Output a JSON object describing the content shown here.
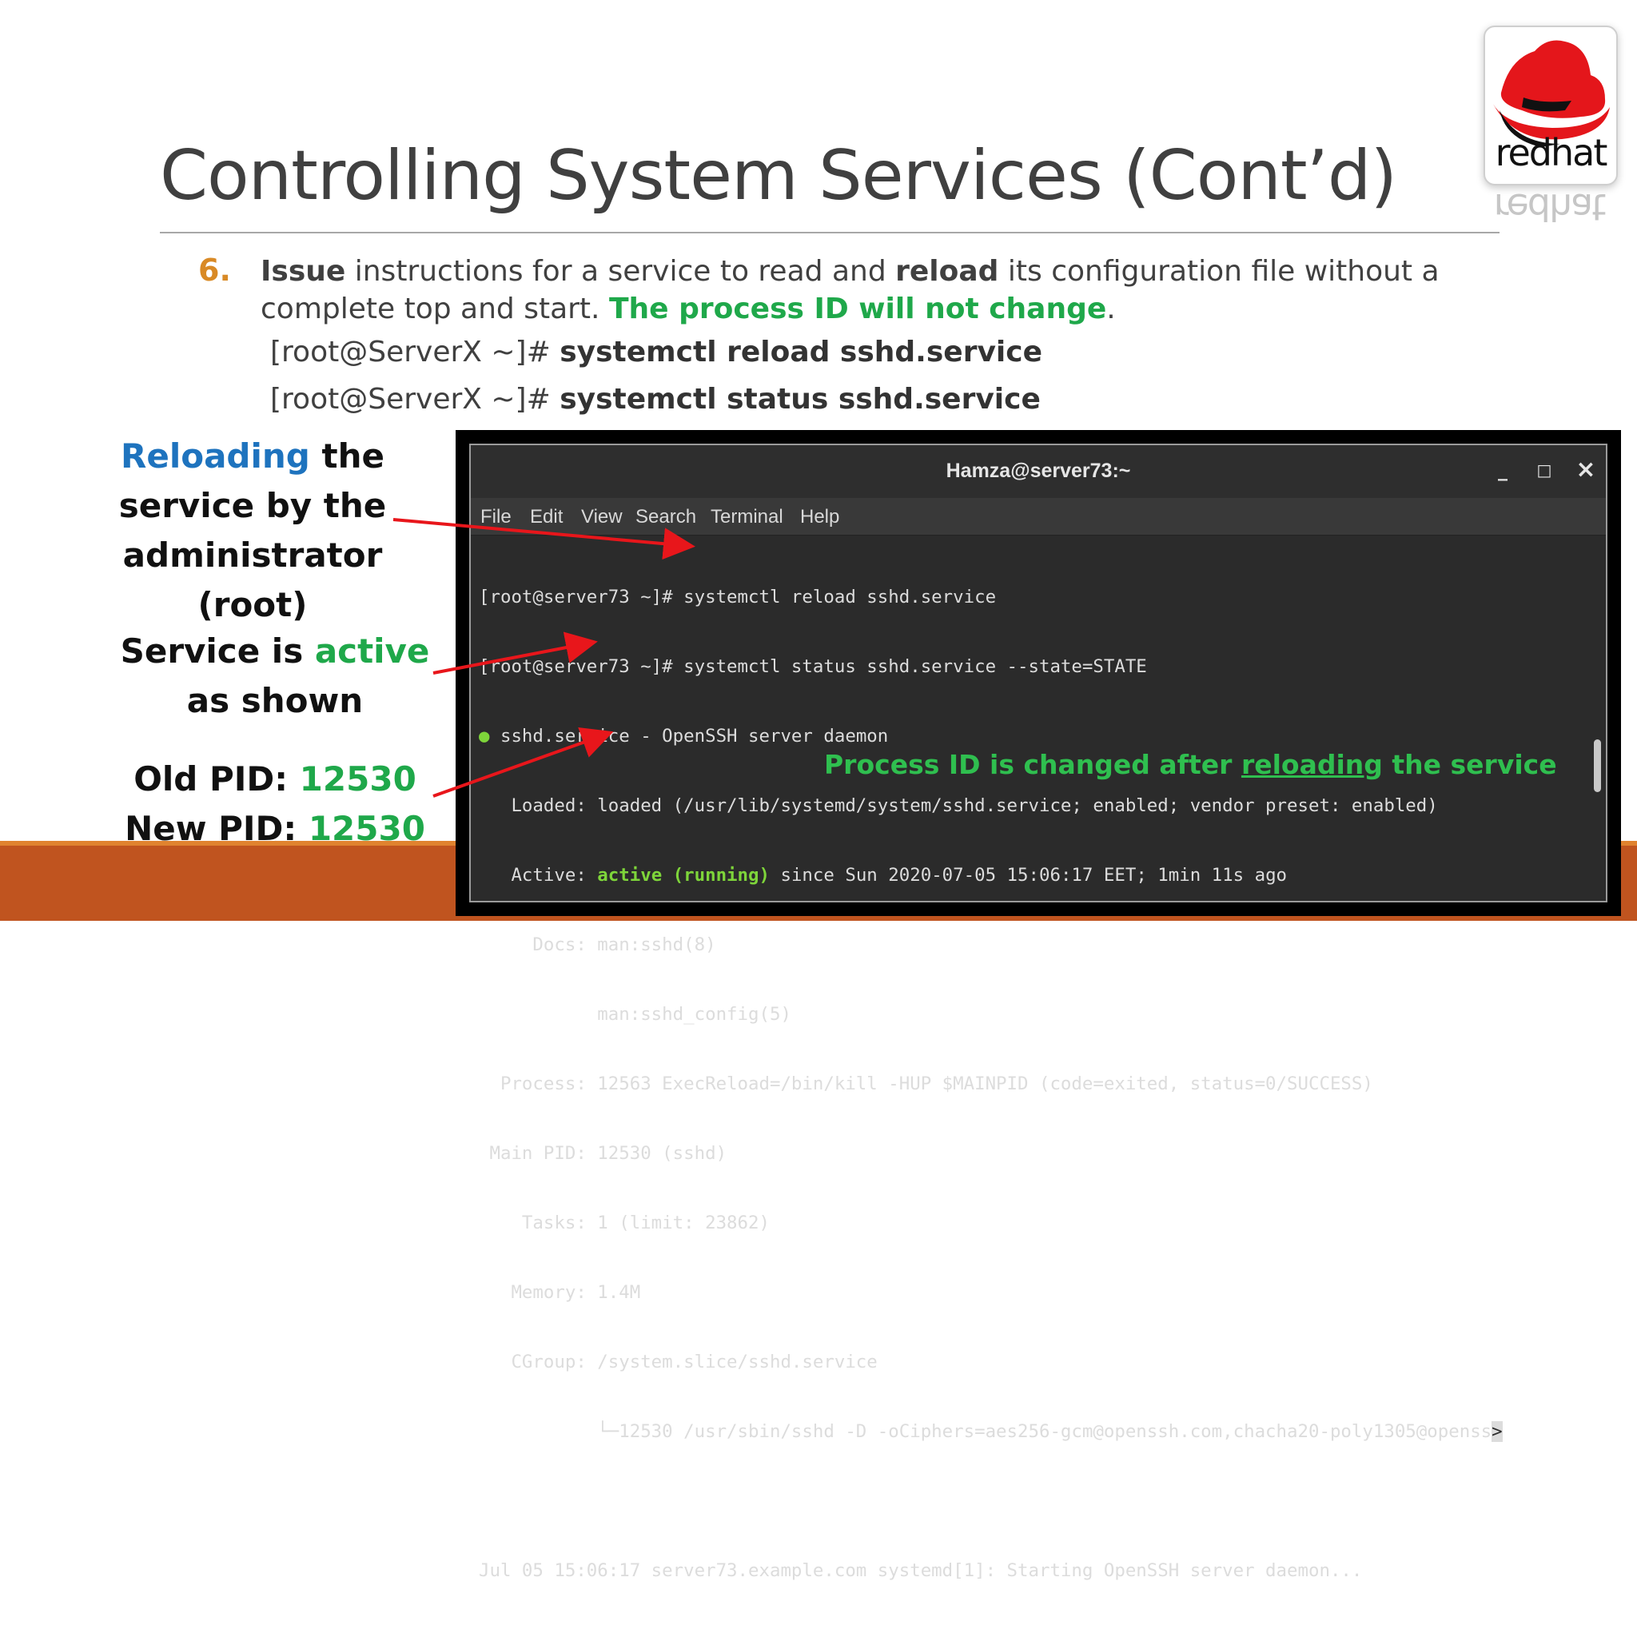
{
  "slide": {
    "title": "Controlling System Services (Cont’d)",
    "logo_text": "redhat"
  },
  "step": {
    "number": "6.",
    "part1_bold": "Issue",
    "part2": " instructions for a service to read and ",
    "part3_bold": "reload",
    "part4": " its configuration file without a complete top and start. ",
    "part5_green": "The process ID will not change",
    "part6": "."
  },
  "commands": [
    {
      "prompt": "[root@ServerX ~]# ",
      "command": "systemctl reload sshd.service"
    },
    {
      "prompt": "[root@ServerX ~]# ",
      "command": "systemctl status sshd.service"
    }
  ],
  "annotations": {
    "reload": {
      "word": "Reloading",
      "rest1": " the",
      "line2": "service by the",
      "line3": "administrator (root)"
    },
    "active": {
      "prefix": "Service is ",
      "word": "active",
      "line2": "as shown"
    },
    "pid": {
      "old_label": "Old PID: ",
      "old_value": "12530",
      "new_label": "New PID: ",
      "new_value": "12530"
    }
  },
  "terminal": {
    "title": "Hamza@server73:~",
    "buttons": {
      "minimize": "_",
      "maximize": "□",
      "close": "×"
    },
    "menu": [
      "File",
      "Edit",
      "View",
      "Search",
      "Terminal",
      "Help"
    ],
    "lines": {
      "l1": "[root@server73 ~]# systemctl reload sshd.service",
      "l2": "[root@server73 ~]# systemctl status sshd.service --state=STATE",
      "l3_dot": "●",
      "l3": " sshd.service - OpenSSH server daemon",
      "l4": "   Loaded: loaded (/usr/lib/systemd/system/sshd.service; enabled; vendor preset: enabled)",
      "l5_pre": "   Active: ",
      "l5_green": "active (running)",
      "l5_post": " since Sun 2020-07-05 15:06:17 EET; 1min 11s ago",
      "l6": "     Docs: man:sshd(8)",
      "l7": "           man:sshd_config(5)",
      "l8": "  Process: 12563 ExecReload=/bin/kill -HUP $MAINPID (code=exited, status=0/SUCCESS)",
      "l9": " Main PID: 12530 (sshd)",
      "l10": "    Tasks: 1 (limit: 23862)",
      "l11": "   Memory: 1.4M",
      "l12": "   CGroup: /system.slice/sshd.service",
      "l13": "           └─12530 /usr/sbin/sshd -D -oCiphers=aes256-gcm@openssh.com,chacha20-poly1305@openss",
      "l13_cursor": ">",
      "l14": "",
      "l15": "Jul 05 15:06:17 server73.example.com systemd[1]: Starting OpenSSH server daemon..."
    },
    "note": {
      "pre": "Process ID is changed after ",
      "underlined": "reloading",
      "post": " the service"
    }
  },
  "colors": {
    "accent_green": "#1fa84a",
    "accent_blue": "#1e73be",
    "number_orange": "#d98a26",
    "bar_orange": "#c0541f",
    "arrow_red": "#e8161b"
  }
}
